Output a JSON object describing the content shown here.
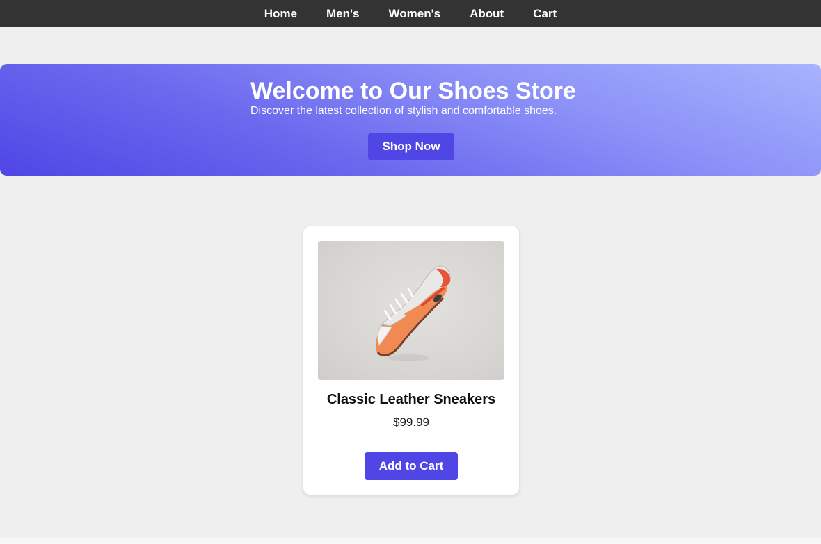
{
  "nav": {
    "items": [
      {
        "label": "Home"
      },
      {
        "label": "Men's"
      },
      {
        "label": "Women's"
      },
      {
        "label": "About"
      },
      {
        "label": "Cart"
      }
    ]
  },
  "hero": {
    "title": "Welcome to Our Shoes Store",
    "subtitle": "Discover the latest collection of stylish and comfortable shoes.",
    "cta_label": "Shop Now"
  },
  "product": {
    "name": "Classic Leather Sneakers",
    "price": "$99.99",
    "add_to_cart_label": "Add to Cart",
    "image_icon": "sneaker-image"
  },
  "colors": {
    "nav_bg": "#333333",
    "accent": "#4f46e5",
    "page_bg": "#efefef"
  }
}
